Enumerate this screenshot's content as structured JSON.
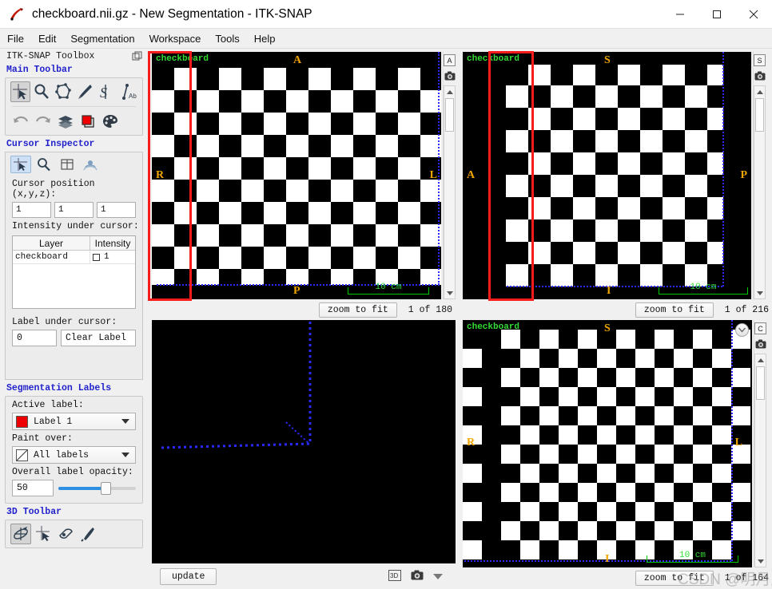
{
  "window": {
    "title": "checkboard.nii.gz - New Segmentation - ITK-SNAP",
    "app_icon": "itksnap-logo-icon",
    "minimize": "—",
    "maximize": "☐",
    "close": "✕"
  },
  "menu": {
    "items": [
      "File",
      "Edit",
      "Segmentation",
      "Workspace",
      "Tools",
      "Help"
    ]
  },
  "sidebar": {
    "toolbox_title": "ITK-SNAP Toolbox",
    "float_icon": "undock-icon",
    "main_toolbar": {
      "header": "Main Toolbar",
      "row1": [
        {
          "name": "crosshair-tool",
          "selected": true
        },
        {
          "name": "zoom-pan-tool",
          "selected": false
        },
        {
          "name": "polygon-tool",
          "selected": false
        },
        {
          "name": "paintbrush-tool",
          "selected": false
        },
        {
          "name": "snake-tool",
          "selected": false
        },
        {
          "name": "annotation-tool",
          "selected": false
        }
      ],
      "row2": [
        {
          "name": "undo-button"
        },
        {
          "name": "redo-button"
        },
        {
          "name": "layers-button"
        },
        {
          "name": "label-color-button"
        },
        {
          "name": "palette-button"
        }
      ]
    },
    "cursor_inspector": {
      "header": "Cursor Inspector",
      "tabs": [
        {
          "name": "crosshair-tab",
          "selected": true
        },
        {
          "name": "zoom-tab",
          "selected": false
        },
        {
          "name": "grid-tab",
          "selected": false
        },
        {
          "name": "registration-tab",
          "selected": false
        }
      ],
      "cursor_position_label": "Cursor position (x,y,z):",
      "cursor_position": [
        "1",
        "1",
        "1"
      ],
      "intensity_label": "Intensity under cursor:",
      "table": {
        "columns": [
          "Layer",
          "Intensity"
        ],
        "rows": [
          {
            "layer": "checkboard",
            "intensity": "1"
          }
        ]
      },
      "label_under_cursor_label": "Label under cursor:",
      "label_id": "0",
      "label_name": "Clear Label"
    },
    "segmentation_labels": {
      "header": "Segmentation Labels",
      "active_label_label": "Active label:",
      "active_label": "Label 1",
      "active_label_color": "#ee0000",
      "paint_over_label": "Paint over:",
      "paint_over": "All labels",
      "opacity_label": "Overall label opacity:",
      "opacity_value": "50"
    },
    "toolbar_3d": {
      "header": "3D Toolbar",
      "items": [
        {
          "name": "trackball-tool",
          "selected": true
        },
        {
          "name": "crosshair-3d-tool",
          "selected": false
        },
        {
          "name": "spray-tool",
          "selected": false
        },
        {
          "name": "scalpel-tool",
          "selected": false
        }
      ]
    }
  },
  "panels": {
    "axial": {
      "layer_label": "checkboard",
      "orient_top": "A",
      "orient_left": "R",
      "orient_right": "L",
      "orient_bottom": "P",
      "scale_text": "10 cm",
      "side_button": "A",
      "camera_icon": "camera-icon",
      "zoom_to_fit": "zoom to fit",
      "slice": "1 of 180"
    },
    "coronal": {
      "layer_label": "checkboard",
      "orient_top": "S",
      "orient_left": "A",
      "orient_right": "P",
      "orient_bottom": "I",
      "scale_text": "10 cm",
      "side_button": "S",
      "camera_icon": "camera-icon",
      "zoom_to_fit": "zoom to fit",
      "slice": "1 of 216"
    },
    "render3d": {
      "update_button": "update",
      "icons": [
        "3d-mode-icon",
        "camera-icon",
        "chevron-down-icon"
      ]
    },
    "sagittal": {
      "layer_label": "checkboard",
      "orient_top": "S",
      "orient_left": "R",
      "orient_right": "L",
      "orient_bottom": "I",
      "scale_text": "10 cm",
      "side_button": "C",
      "camera_icon": "camera-icon",
      "expand_icon": "chevron-down-circle-icon",
      "zoom_to_fit": "zoom to fit",
      "slice": "1 of 164"
    }
  },
  "watermark": {
    "text": "CSDN @明月正"
  },
  "colors": {
    "layer_label_green": "#33dd33",
    "orientation_orange": "#f0a500",
    "crosshair_blue": "#2a2aff",
    "scalebar_green": "#00cc00",
    "annotation_red": "#f71b1b",
    "section_header_blue": "#2222cc"
  }
}
